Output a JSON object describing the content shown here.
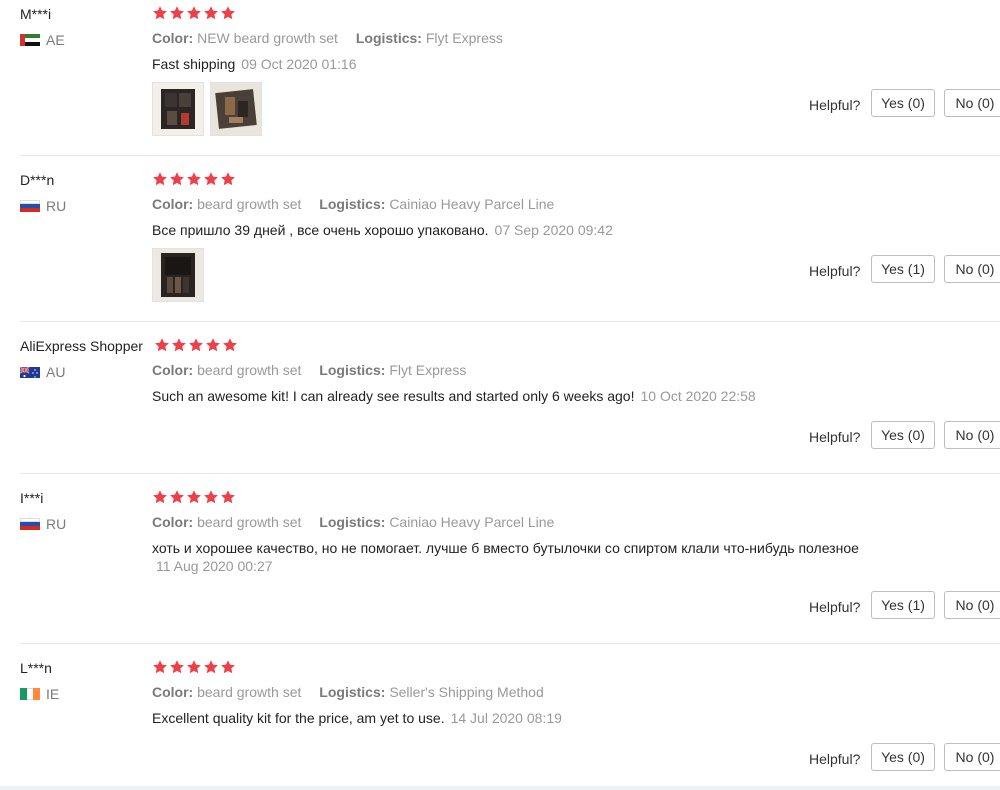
{
  "labels": {
    "color": "Color:",
    "logistics": "Logistics:",
    "helpful": "Helpful?"
  },
  "colors": {
    "star": "#ee4049",
    "muted": "#999999",
    "border": "#bdbdbd"
  },
  "reviews": [
    {
      "user": "M***i",
      "country": "AE",
      "flag": "ae-flag-icon",
      "stars": 5,
      "color": "NEW beard growth set",
      "logistics": "Flyt Express",
      "content": "Fast shipping",
      "date": "09 Oct 2020 01:16",
      "photos": 2,
      "yes": "Yes (0)",
      "no": "No (0)"
    },
    {
      "user": "D***n",
      "country": "RU",
      "flag": "ru-flag-icon",
      "stars": 5,
      "color": "beard growth set",
      "logistics": "Cainiao Heavy Parcel Line",
      "content": "Все пришло 39 дней , все очень хорошо упаковано.",
      "date": "07 Sep 2020 09:42",
      "photos": 1,
      "yes": "Yes (1)",
      "no": "No (0)"
    },
    {
      "user": "AliExpress Shopper",
      "country": "AU",
      "flag": "au-flag-icon",
      "stars": 5,
      "color": "beard growth set",
      "logistics": "Flyt Express",
      "content": "Such an awesome kit! I can already see results and started only 6 weeks ago!",
      "date": "10 Oct 2020 22:58",
      "photos": 0,
      "yes": "Yes (0)",
      "no": "No (0)"
    },
    {
      "user": "I***i",
      "country": "RU",
      "flag": "ru-flag-icon",
      "stars": 5,
      "color": "beard growth set",
      "logistics": "Cainiao Heavy Parcel Line",
      "content": "хоть и хорошее качество, но не помогает. лучше б вместо бутылочки со спиртом клали что-нибудь полезное",
      "date": "11 Aug 2020 00:27",
      "photos": 0,
      "yes": "Yes (1)",
      "no": "No (0)"
    },
    {
      "user": "L***n",
      "country": "IE",
      "flag": "ie-flag-icon",
      "stars": 5,
      "color": "beard growth set",
      "logistics": "Seller's Shipping Method",
      "content": "Excellent quality kit for the price, am yet to use.",
      "date": "14 Jul 2020 08:19",
      "photos": 0,
      "yes": "Yes (0)",
      "no": "No (0)"
    }
  ]
}
